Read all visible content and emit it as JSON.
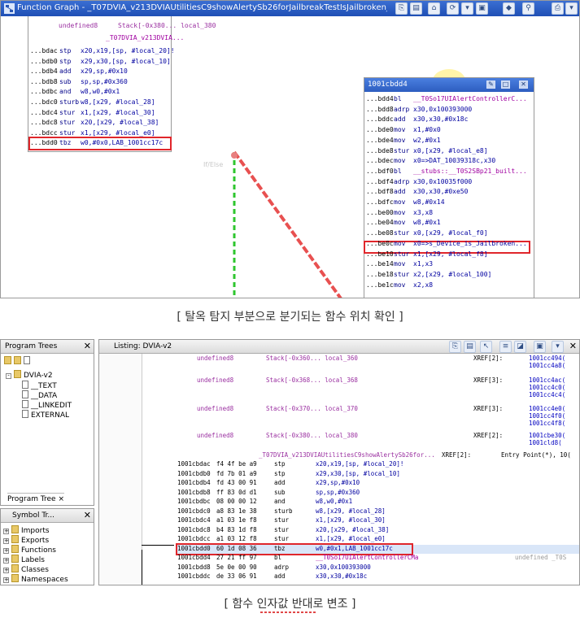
{
  "top": {
    "window_title": "Function Graph - _T07DVIA_v213DVIAUtilitiesC9showAlertySb26forJailbreakTestIsJailbroken_So16UIViewController...",
    "toolbar_icons": [
      "copy-icon",
      "paste-icon",
      "home-icon",
      "refresh-icon",
      "snapshot-icon",
      "navigate-icon",
      "zoom-icon",
      "print-icon"
    ],
    "block1": {
      "header": [
        {
          "l": "undefined8",
          "r": "Stack[-0x380... local_380"
        },
        {
          "l": "",
          "r": "_T07DVIA_v213DVIA..."
        }
      ],
      "lines": [
        {
          "a": "...bdac",
          "m": "stp",
          "o": "x20,x19,[sp, #local_20]!"
        },
        {
          "a": "...bdb0",
          "m": "stp",
          "o": "x29,x30,[sp, #local_10]"
        },
        {
          "a": "...bdb4",
          "m": "add",
          "o": "x29,sp,#0x10"
        },
        {
          "a": "...bdb8",
          "m": "sub",
          "o": "sp,sp,#0x360"
        },
        {
          "a": "...bdbc",
          "m": "and",
          "o": "w8,w0,#0x1"
        },
        {
          "a": "...bdc0",
          "m": "sturb",
          "o": "w8,[x29, #local_28]"
        },
        {
          "a": "...bdc4",
          "m": "stur",
          "o": "x1,[x29, #local_30]"
        },
        {
          "a": "...bdc8",
          "m": "stur",
          "o": "x20,[x29, #local_38]"
        },
        {
          "a": "...bdcc",
          "m": "stur",
          "o": "x1,[x29, #local_e0]"
        },
        {
          "a": "...bdd0",
          "m": "tbz",
          "o": "w0,#0x0,LAB_1001cc17c"
        }
      ]
    },
    "edge_label": "If/Else",
    "block2": {
      "title": "1001cbdd4",
      "lines": [
        {
          "a": "...bdd4",
          "m": "bl",
          "o": "__T0So17UIAlertControllerC..."
        },
        {
          "a": "...bdd8",
          "m": "adrp",
          "o": "x30,0x100393000"
        },
        {
          "a": "...bddc",
          "m": "add",
          "o": "x30,x30,#0x18c"
        },
        {
          "a": "...bde0",
          "m": "mov",
          "o": "x1,#0x0"
        },
        {
          "a": "...bde4",
          "m": "mov",
          "o": "w2,#0x1"
        },
        {
          "a": "...bde8",
          "m": "stur",
          "o": "x0,[x29, #local_e8]"
        },
        {
          "a": "...bdec",
          "m": "mov",
          "o": "x0=>DAT_10039318c,x30"
        },
        {
          "a": "...bdf0",
          "m": "bl",
          "o": "__stubs::__T0S2SBp21_built..."
        },
        {
          "a": "...bdf4",
          "m": "adrp",
          "o": "x30,0x10035f000"
        },
        {
          "a": "...bdf8",
          "m": "add",
          "o": "x30,x30,#0xe50"
        },
        {
          "a": "...bdfc",
          "m": "mov",
          "o": "w8,#0x14"
        },
        {
          "a": "...be00",
          "m": "mov",
          "o": "x3,x8"
        },
        {
          "a": "...be04",
          "m": "mov",
          "o": "w8,#0x1"
        },
        {
          "a": "...be08",
          "m": "stur",
          "o": "x0,[x29, #local_f0]"
        },
        {
          "a": "...be0c",
          "m": "mov",
          "o": "x0=>s_Device_is_Jailbroken..."
        },
        {
          "a": "...be10",
          "m": "stur",
          "o": "x1,[x29, #local_f8]"
        },
        {
          "a": "...be14",
          "m": "mov",
          "o": "x1,x3"
        },
        {
          "a": "...be18",
          "m": "stur",
          "o": "x2,[x29, #local_100]"
        },
        {
          "a": "...be1c",
          "m": "mov",
          "o": "x2,x8"
        }
      ]
    }
  },
  "caption1": "[ 탈옥 탐지 부분으로 분기되는 함수 위치 확인 ]",
  "bottom": {
    "program_trees": {
      "title": "Program Trees",
      "root": "DVIA-v2",
      "children": [
        "__TEXT",
        "__DATA",
        "__LINKEDIT",
        "EXTERNAL"
      ],
      "tab": "Program Tree ×"
    },
    "symbol_tree": {
      "title": "Symbol Tr...",
      "items": [
        "Imports",
        "Exports",
        "Functions",
        "Labels",
        "Classes",
        "Namespaces"
      ]
    },
    "listing": {
      "title": "Listing:  DVIA-v2",
      "vars": [
        {
          "t": "undefined8",
          "s": "Stack[-0x360... local_360",
          "x": "XREF[2]:",
          "xa": [
            "1001cc494(",
            "1001cc4a8("
          ]
        },
        {
          "t": "undefined8",
          "s": "Stack[-0x368... local_368",
          "x": "XREF[3]:",
          "xa": [
            "1001cc4ac(",
            "1001cc4c0(",
            "1001cc4c4("
          ]
        },
        {
          "t": "undefined8",
          "s": "Stack[-0x370... local_370",
          "x": "XREF[3]:",
          "xa": [
            "1001cc4e0(",
            "1001cc4f0(",
            "1001cc4f8("
          ]
        },
        {
          "t": "undefined8",
          "s": "Stack[-0x380... local_380",
          "x": "XREF[2]:",
          "xa": [
            "1001cbe30(",
            "1001cld8("
          ]
        }
      ],
      "func_label": "_T07DVIA_v213DVIAUtilitiesC9showAlertySb26for...",
      "func_xref": "XREF[2]:",
      "func_entry": "Entry Point(*), 10(",
      "rows": [
        {
          "a": "1001cbdac",
          "b": "f4 4f be a9",
          "m": "stp",
          "o": "x20,x19,[sp, #local_20]!"
        },
        {
          "a": "1001cbdb0",
          "b": "fd 7b 01 a9",
          "m": "stp",
          "o": "x29,x30,[sp, #local_10]"
        },
        {
          "a": "1001cbdb4",
          "b": "fd 43 00 91",
          "m": "add",
          "o": "x29,sp,#0x10"
        },
        {
          "a": "1001cbdb8",
          "b": "ff 83 0d d1",
          "m": "sub",
          "o": "sp,sp,#0x360"
        },
        {
          "a": "1001cbdbc",
          "b": "08 00 00 12",
          "m": "and",
          "o": "w8,w0,#0x1"
        },
        {
          "a": "1001cbdc0",
          "b": "a8 83 1e 38",
          "m": "sturb",
          "o": "w8,[x29, #local_28]"
        },
        {
          "a": "1001cbdc4",
          "b": "a1 03 1e f8",
          "m": "stur",
          "o": "x1,[x29, #local_30]"
        },
        {
          "a": "1001cbdc8",
          "b": "b4 83 1d f8",
          "m": "stur",
          "o": "x20,[x29, #local_38]"
        },
        {
          "a": "1001cbdcc",
          "b": "a1 03 12 f8",
          "m": "stur",
          "o": "x1,[x29, #local_e0]"
        },
        {
          "a": "1001cbdd0",
          "b": "60 1d 08 36",
          "m": "tbz",
          "o": "w0,#0x1,LAB_1001cc17c"
        },
        {
          "a": "1001cbdd4",
          "b": "27 21 ff 97",
          "m": "bl",
          "o": "__T0So17UIAlertControllerCMa",
          "x": "undefined _T0S"
        },
        {
          "a": "1001cbdd8",
          "b": "5e 0e 00 90",
          "m": "adrp",
          "o": "x30,0x100393000"
        },
        {
          "a": "1001cbddc",
          "b": "de 33 06 91",
          "m": "add",
          "o": "x30,x30,#0x18c"
        }
      ]
    }
  },
  "caption2": "[ 함수 인자값 반대로 변조 ]"
}
